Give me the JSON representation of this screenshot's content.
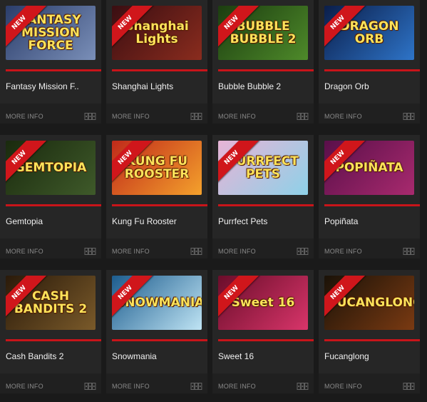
{
  "badge_label": "NEW",
  "more_info_label": "MORE INFO",
  "games": [
    {
      "name": "Fantasy Mission F..",
      "art": "FANTASY MISSION FORCE",
      "bg": [
        "#2b3d6a",
        "#7a8fb8"
      ]
    },
    {
      "name": "Shanghai Lights",
      "art": "Shanghai Lights",
      "bg": [
        "#3a0e12",
        "#8a2c1e"
      ]
    },
    {
      "name": "Bubble Bubble 2",
      "art": "BUBBLE BUBBLE 2",
      "bg": [
        "#1c3d10",
        "#4e8a2a"
      ]
    },
    {
      "name": "Dragon Orb",
      "art": "DRAGON ORB",
      "bg": [
        "#0b1e4a",
        "#2e74c8"
      ]
    },
    {
      "name": "Gemtopia",
      "art": "GEMTOPIA",
      "bg": [
        "#1a2a0e",
        "#3f5a2a"
      ]
    },
    {
      "name": "Kung Fu Rooster",
      "art": "KUNG FU ROOSTER",
      "bg": [
        "#c02a1a",
        "#f4a12c"
      ]
    },
    {
      "name": "Purrfect Pets",
      "art": "PURRFECT PETS",
      "bg": [
        "#e7b4d6",
        "#8ed1e8"
      ]
    },
    {
      "name": "Popiñata",
      "art": "POPIÑATA",
      "bg": [
        "#5a0f4a",
        "#a82a6e"
      ]
    },
    {
      "name": "Cash Bandits 2",
      "art": "CASH BANDITS 2",
      "bg": [
        "#2a1a0a",
        "#7a5a2a"
      ]
    },
    {
      "name": "Snowmania",
      "art": "SNOWMANIA",
      "bg": [
        "#1c5c8e",
        "#bfe4f4"
      ]
    },
    {
      "name": "Sweet 16",
      "art": "Sweet 16",
      "bg": [
        "#6a0d2a",
        "#d8356a"
      ]
    },
    {
      "name": "Fucanglong",
      "art": "FUCANGLONG",
      "bg": [
        "#1a1208",
        "#7a3a12"
      ]
    }
  ]
}
